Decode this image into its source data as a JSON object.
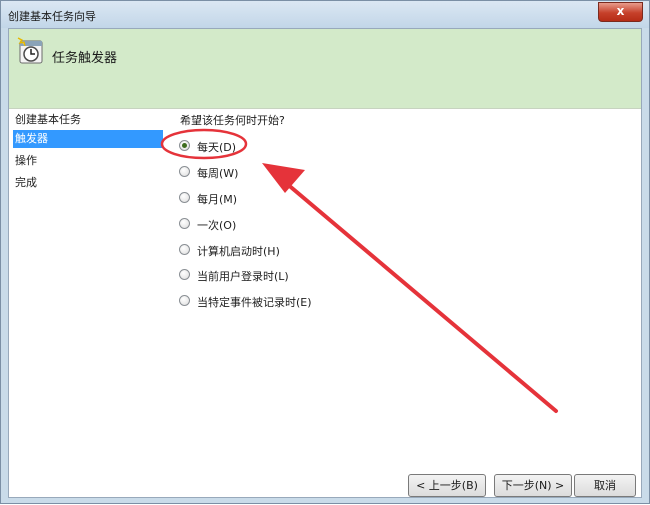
{
  "window": {
    "title": "创建基本任务向导",
    "close_glyph": "x"
  },
  "header": {
    "title": "任务触发器",
    "icon": "clock-calendar-icon"
  },
  "nav": {
    "items": [
      "创建基本任务",
      "触发器",
      "操作",
      "完成"
    ],
    "selected_index": 1
  },
  "content": {
    "question": "希望该任务何时开始?",
    "options": [
      "每天(D)",
      "每周(W)",
      "每月(M)",
      "一次(O)",
      "计算机启动时(H)",
      "当前用户登录时(L)",
      "当特定事件被记录时(E)"
    ],
    "selected_option": "每天(D)"
  },
  "buttons": {
    "back": "< 上一步(B)",
    "next": "下一步(N) >",
    "cancel": "取消"
  },
  "colors": {
    "header_bg": "#d3eac9",
    "nav_selected": "#3399ff",
    "annotation": "#e5333a"
  }
}
